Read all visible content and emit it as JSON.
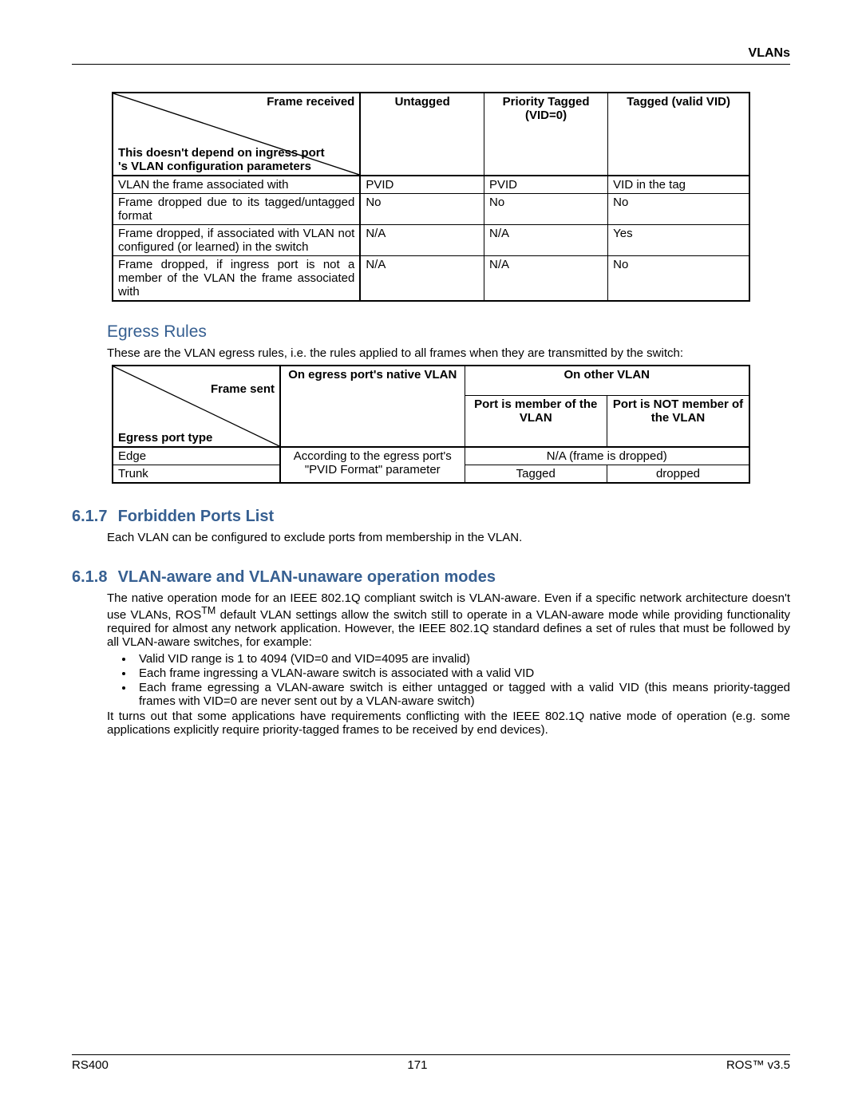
{
  "header": {
    "title": "VLANs"
  },
  "table1": {
    "diag_top": "Frame received",
    "diag_bottom": "This doesn't depend on ingress port 's VLAN configuration parameters",
    "cols": [
      "Untagged",
      "Priority Tagged (VID=0)",
      "Tagged (valid VID)"
    ],
    "rows": [
      {
        "label": "VLAN the frame associated with",
        "c": [
          "PVID",
          "PVID",
          "VID in the tag"
        ]
      },
      {
        "label": "Frame dropped due to its tagged/untagged format",
        "c": [
          "No",
          "No",
          "No"
        ]
      },
      {
        "label": "Frame dropped, if associated with VLAN not configured (or learned) in the switch",
        "c": [
          "N/A",
          "N/A",
          "Yes"
        ]
      },
      {
        "label": "Frame dropped, if ingress port is not a member of the VLAN the frame associated with",
        "c": [
          "N/A",
          "N/A",
          "No"
        ]
      }
    ]
  },
  "egress": {
    "heading": "Egress Rules",
    "intro": "These are the VLAN egress rules, i.e. the rules applied to all frames when they are transmitted by the switch:"
  },
  "table2": {
    "diag_top": "Frame sent",
    "diag_bottom": "Egress port type",
    "col_native": "On egress port's native VLAN",
    "col_other": "On other VLAN",
    "sub_member": "Port is member of the VLAN",
    "sub_not": "Port is NOT member of the VLAN",
    "native_val": "According to the egress port's \"PVID Format\" parameter",
    "rows": [
      {
        "label": "Edge",
        "member": "N/A (frame is dropped)",
        "not": ""
      },
      {
        "label": "Trunk",
        "member": "Tagged",
        "not": "dropped"
      }
    ]
  },
  "sec617": {
    "num": "6.1.7",
    "title": "Forbidden Ports List",
    "text": "Each VLAN can be configured to exclude ports from membership in the VLAN."
  },
  "sec618": {
    "num": "6.1.8",
    "title": "VLAN-aware and VLAN-unaware operation modes",
    "p1a": "The native operation mode for an IEEE 802.1Q compliant switch is VLAN-aware. Even if a specific network architecture doesn't use VLANs, ROS",
    "p1b": " default VLAN settings allow the switch still to operate in a VLAN-aware mode while providing functionality required for almost any network application. However, the IEEE 802.1Q standard defines a set of rules that must be followed by all VLAN-aware switches, for example:",
    "bullets": [
      "Valid VID range is 1 to 4094 (VID=0 and VID=4095 are invalid)",
      "Each frame ingressing a VLAN-aware switch is associated with a valid VID",
      "Each frame egressing a VLAN-aware switch is either untagged or tagged with a valid VID (this means priority-tagged frames with VID=0 are never sent out by a VLAN-aware switch)"
    ],
    "p2": "It turns out that some applications have requirements conflicting with the IEEE 802.1Q native mode of operation (e.g. some applications explicitly require priority-tagged frames to be received by end devices)."
  },
  "footer": {
    "left": "RS400",
    "center": "171",
    "right": "ROS™  v3.5"
  }
}
